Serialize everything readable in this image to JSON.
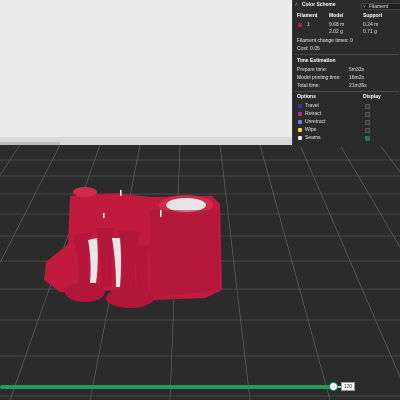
{
  "legend": {
    "color_scheme_label": "Color Scheme",
    "color_scheme_value": "Filament",
    "filament_headers": [
      "Filament",
      "Model",
      "Support"
    ],
    "filament_row": {
      "index": "1",
      "model_length": "9.68 m",
      "model_weight": "2.02 g",
      "support_length": "0.24 m",
      "support_weight": "0.71 g"
    },
    "filament_change": "Filament change times: 0",
    "cost": "Cost: 0.05",
    "time_estimation_header": "Time Estimation",
    "prepare_time_label": "Prepare time:",
    "prepare_time_value": "5m33s",
    "model_printing_label": "Model printing time:",
    "model_printing_value": "16m2s",
    "total_time_label": "Total time:",
    "total_time_value": "21m36s",
    "options_header": "Options",
    "display_header": "Display",
    "options": [
      {
        "label": "Travel",
        "color": "#2d3aa6",
        "checked": false
      },
      {
        "label": "Retract",
        "color": "#b02ab8",
        "checked": false
      },
      {
        "label": "Unretract",
        "color": "#5a8fd0",
        "checked": false
      },
      {
        "label": "Wipe",
        "color": "#e8e21e",
        "checked": false
      },
      {
        "label": "Seams",
        "color": "#e6e6e6",
        "checked": true
      }
    ],
    "filament_color": "#c01a3e"
  },
  "layer_slider": {
    "value": "120",
    "accent_color": "#1f9c5a"
  },
  "scene": {
    "plate_color": "#2a2a2a",
    "grid_color": "#6a6a6a",
    "model_color": "#c01a3e"
  }
}
